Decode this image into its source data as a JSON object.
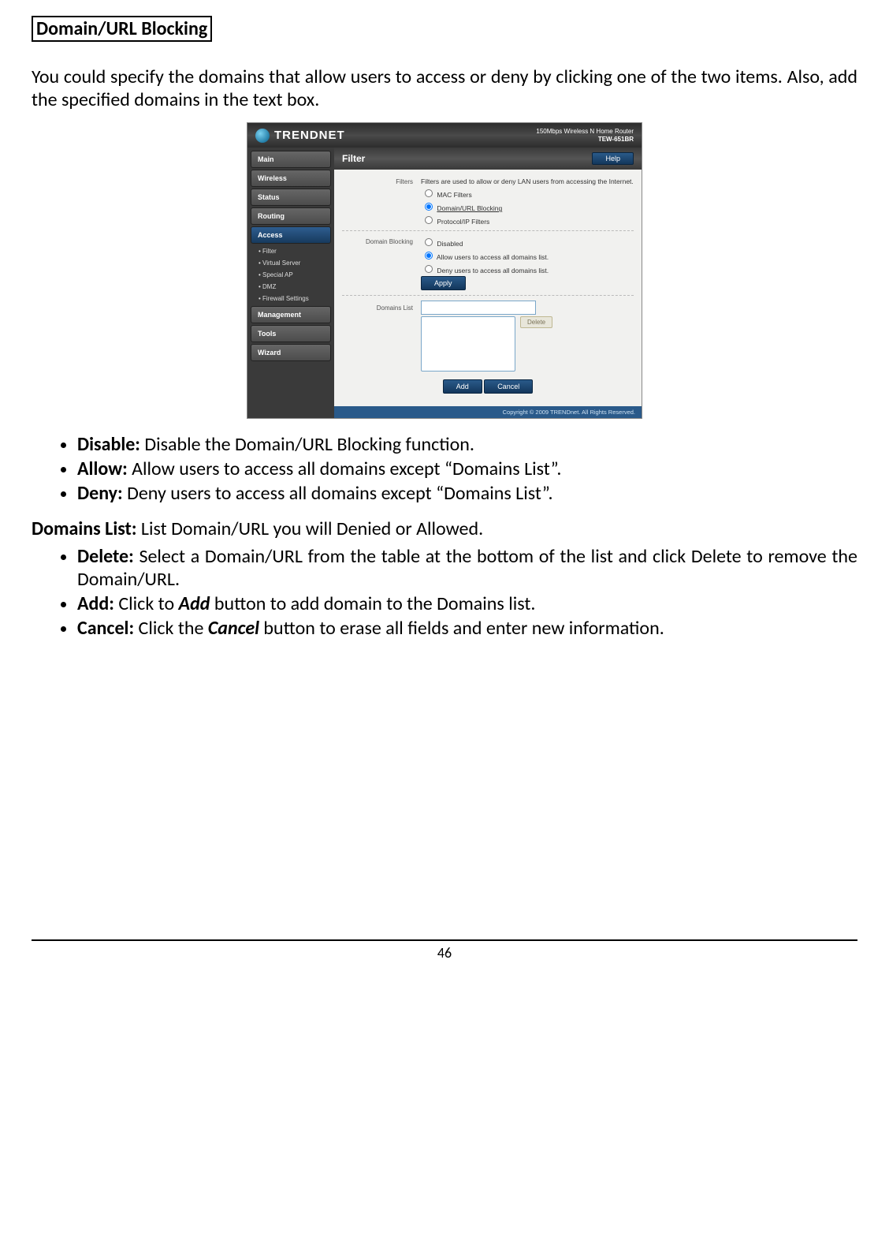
{
  "page": {
    "title": "Domain/URL Blocking",
    "intro": "You could specify the domains that allow users to access or deny by clicking one of the two items.  Also, add the specified domains in the text box.",
    "domains_list_heading_label": "Domains List:",
    "domains_list_heading_text": "List Domain/URL you will Denied or Allowed.",
    "page_number": "46"
  },
  "bullets1": [
    {
      "label": "Disable:",
      "text": "Disable the Domain/URL Blocking function."
    },
    {
      "label": "Allow:",
      "text": "Allow users to access all domains except “Domains List”."
    },
    {
      "label": "Deny:",
      "text": "Deny users to access all domains except “Domains List”."
    }
  ],
  "bullets2": [
    {
      "label": "Delete:",
      "text": "Select a Domain/URL from the table at the bottom of the list and click Delete to remove the Domain/URL."
    },
    {
      "label": "Add:",
      "prefix": "Click to ",
      "em": "Add",
      "suffix": " button to add domain to the Domains list."
    },
    {
      "label": "Cancel:",
      "prefix": "Click the ",
      "em": "Cancel",
      "suffix": " button to erase all fields and enter new information."
    }
  ],
  "router": {
    "brand": "TRENDNET",
    "model_line1": "150Mbps Wireless N Home Router",
    "model_line2": "TEW-651BR",
    "sidebar": {
      "items": [
        "Main",
        "Wireless",
        "Status",
        "Routing",
        "Access",
        "Management",
        "Tools",
        "Wizard"
      ],
      "active": "Access",
      "sub": [
        "Filter",
        "Virtual Server",
        "Special AP",
        "DMZ",
        "Firewall Settings"
      ]
    },
    "panel": {
      "title": "Filter",
      "help": "Help",
      "filters_label": "Filters",
      "filters_desc": "Filters are used to allow or deny LAN users from accessing the Internet.",
      "opt_mac": "MAC Filters",
      "opt_domain": "Domain/URL Blocking",
      "opt_protocol": "Protocol/IP Filters",
      "domain_blocking_label": "Domain Blocking",
      "db_disabled": "Disabled",
      "db_allow": "Allow users to access all domains list.",
      "db_deny": "Deny users to access all domains list.",
      "apply": "Apply",
      "domains_list_label": "Domains List",
      "delete": "Delete",
      "add": "Add",
      "cancel": "Cancel",
      "footer": "Copyright © 2009 TRENDnet. All Rights Reserved."
    }
  }
}
